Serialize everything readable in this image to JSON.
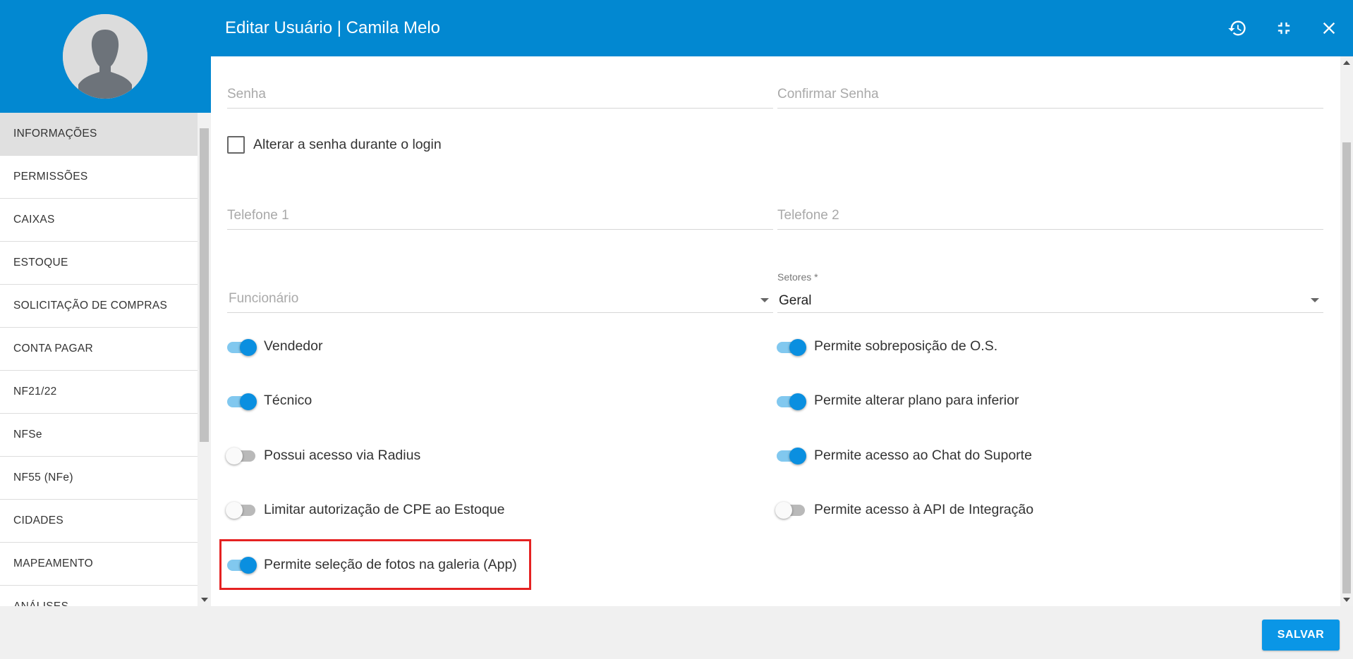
{
  "header": {
    "title": "Editar Usuário | Camila Melo",
    "icons": [
      "history-icon",
      "compress-icon",
      "close-icon"
    ],
    "color": "#0288d1"
  },
  "sidebar": {
    "items": [
      {
        "label": "INFORMAÇÕES",
        "active": true
      },
      {
        "label": "PERMISSÕES"
      },
      {
        "label": "CAIXAS"
      },
      {
        "label": "ESTOQUE"
      },
      {
        "label": "SOLICITAÇÃO DE COMPRAS"
      },
      {
        "label": "CONTA PAGAR"
      },
      {
        "label": "NF21/22"
      },
      {
        "label": "NFSe"
      },
      {
        "label": "NF55 (NFe)"
      },
      {
        "label": "CIDADES"
      },
      {
        "label": "MAPEAMENTO"
      },
      {
        "label": "ANÁLISES"
      }
    ]
  },
  "form": {
    "senha_placeholder": "Senha",
    "confirmar_senha_placeholder": "Confirmar Senha",
    "alterar_senha_label": "Alterar a senha durante o login",
    "alterar_senha_checked": false,
    "telefone1_placeholder": "Telefone 1",
    "telefone2_placeholder": "Telefone 2",
    "funcionario_placeholder": "Funcionário",
    "setores_label": "Setores *",
    "setores_value": "Geral"
  },
  "toggles": {
    "vendedor": {
      "label": "Vendedor",
      "on": true
    },
    "tecnico": {
      "label": "Técnico",
      "on": true
    },
    "radius": {
      "label": "Possui acesso via Radius",
      "on": false
    },
    "cpe": {
      "label": "Limitar autorização de CPE ao Estoque",
      "on": false
    },
    "fotos": {
      "label": "Permite seleção de fotos na galeria (App)",
      "on": true
    },
    "sobreposicao": {
      "label": "Permite sobreposição de O.S.",
      "on": true
    },
    "plano": {
      "label": "Permite alterar plano para inferior",
      "on": true
    },
    "chat": {
      "label": "Permite acesso ao Chat do Suporte",
      "on": true
    },
    "api": {
      "label": "Permite acesso à API de Integração",
      "on": false
    }
  },
  "footer": {
    "save_label": "SALVAR",
    "save_color": "#0a96e6"
  }
}
